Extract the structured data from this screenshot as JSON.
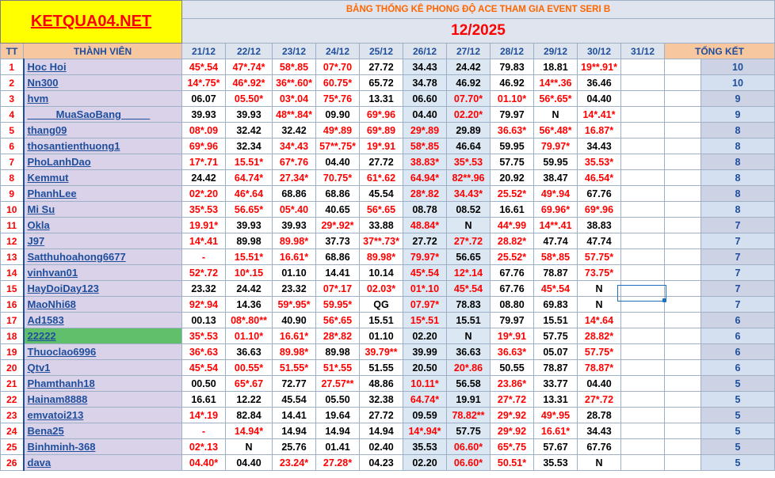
{
  "sheet": {
    "logo": "KETQUA04.NET",
    "title": "BẢNG THỐNG KÊ PHONG ĐỘ ACE THAM GIA EVENT SERI B",
    "period": "12/2025",
    "col_tt": "TT",
    "col_member": "THÀNH VIÊN",
    "col_total": "TỔNG KẾT",
    "dates": [
      "21/12",
      "22/12",
      "23/12",
      "24/12",
      "25/12",
      "26/12",
      "27/12",
      "28/12",
      "29/12",
      "30/12",
      "31/12"
    ]
  },
  "colors": {
    "red": "#ff0000",
    "black": "#000000",
    "name_bg": "#d9d2e9",
    "highlight": "#5fbf6a",
    "header_orange": "#f7c7a0"
  },
  "rows": [
    {
      "tt": "1",
      "name": "Hoc Hoi",
      "cells": [
        [
          "45*.54",
          "r"
        ],
        [
          "47*.74*",
          "r"
        ],
        [
          "58*.85",
          "r"
        ],
        [
          "07*.70",
          "r"
        ],
        [
          "27.72",
          "b"
        ],
        [
          "34.43",
          "b"
        ],
        [
          "24.42",
          "b"
        ],
        [
          "79.83",
          "b"
        ],
        [
          "18.81",
          "b"
        ],
        [
          "19**.91*",
          "r"
        ],
        [
          "",
          ""
        ]
      ],
      "total": "10"
    },
    {
      "tt": "2",
      "name": "Nn300",
      "cells": [
        [
          "14*.75*",
          "r"
        ],
        [
          "46*.92*",
          "r"
        ],
        [
          "36**.60*",
          "r"
        ],
        [
          "60.75*",
          "r"
        ],
        [
          "65.72",
          "b"
        ],
        [
          "34.78",
          "b"
        ],
        [
          "46.92",
          "b"
        ],
        [
          "46.92",
          "b"
        ],
        [
          "14**.36",
          "r"
        ],
        [
          "36.46",
          "b"
        ],
        [
          "",
          ""
        ]
      ],
      "total": "10"
    },
    {
      "tt": "3",
      "name": "hvm",
      "cells": [
        [
          "06.07",
          "b"
        ],
        [
          "05.50*",
          "r"
        ],
        [
          "03*.04",
          "r"
        ],
        [
          "75*.76",
          "r"
        ],
        [
          "13.31",
          "b"
        ],
        [
          "06.60",
          "b"
        ],
        [
          "07.70*",
          "r"
        ],
        [
          "01.10*",
          "r"
        ],
        [
          "56*.65*",
          "r"
        ],
        [
          "04.40",
          "b"
        ],
        [
          "",
          ""
        ]
      ],
      "total": "9"
    },
    {
      "tt": "4",
      "name": "_____MuaSaoBang_____",
      "cells": [
        [
          "39.93",
          "b"
        ],
        [
          "39.93",
          "b"
        ],
        [
          "48**.84*",
          "r"
        ],
        [
          "09.90",
          "b"
        ],
        [
          "69*.96",
          "r"
        ],
        [
          "04.40",
          "b"
        ],
        [
          "02.20*",
          "r"
        ],
        [
          "79.97",
          "b"
        ],
        [
          "N",
          "b"
        ],
        [
          "14*.41*",
          "r"
        ],
        [
          "",
          ""
        ]
      ],
      "total": "9"
    },
    {
      "tt": "5",
      "name": "thang09",
      "cells": [
        [
          "08*.09",
          "r"
        ],
        [
          "32.42",
          "b"
        ],
        [
          "32.42",
          "b"
        ],
        [
          "49*.89",
          "r"
        ],
        [
          "69*.89",
          "r"
        ],
        [
          "29*.89",
          "r"
        ],
        [
          "29.89",
          "b"
        ],
        [
          "36.63*",
          "r"
        ],
        [
          "56*.48*",
          "r"
        ],
        [
          "16.87*",
          "r"
        ],
        [
          "",
          ""
        ]
      ],
      "total": "8"
    },
    {
      "tt": "6",
      "name": "thosantienthuong1",
      "cells": [
        [
          "69*.96",
          "r"
        ],
        [
          "32.34",
          "b"
        ],
        [
          "34*.43",
          "r"
        ],
        [
          "57**.75*",
          "r"
        ],
        [
          "19*.91",
          "r"
        ],
        [
          "58*.85",
          "r"
        ],
        [
          "46.64",
          "b"
        ],
        [
          "59.95",
          "b"
        ],
        [
          "79.97*",
          "r"
        ],
        [
          "34.43",
          "b"
        ],
        [
          "",
          ""
        ]
      ],
      "total": "8"
    },
    {
      "tt": "7",
      "name": "PhoLanhDao",
      "cells": [
        [
          "17*.71",
          "r"
        ],
        [
          "15.51*",
          "r"
        ],
        [
          "67*.76",
          "r"
        ],
        [
          "04.40",
          "b"
        ],
        [
          "27.72",
          "b"
        ],
        [
          "38.83*",
          "r"
        ],
        [
          "35*.53",
          "r"
        ],
        [
          "57.75",
          "b"
        ],
        [
          "59.95",
          "b"
        ],
        [
          "35.53*",
          "r"
        ],
        [
          "",
          ""
        ]
      ],
      "total": "8"
    },
    {
      "tt": "8",
      "name": "Kemmut",
      "cells": [
        [
          "24.42",
          "b"
        ],
        [
          "64.74*",
          "r"
        ],
        [
          "27.34*",
          "r"
        ],
        [
          "70.75*",
          "r"
        ],
        [
          "61*.62",
          "r"
        ],
        [
          "64.94*",
          "r"
        ],
        [
          "82**.96",
          "r"
        ],
        [
          "20.92",
          "b"
        ],
        [
          "38.47",
          "b"
        ],
        [
          "46.54*",
          "r"
        ],
        [
          "",
          ""
        ]
      ],
      "total": "8"
    },
    {
      "tt": "9",
      "name": "PhanhLee",
      "cells": [
        [
          "02*.20",
          "r"
        ],
        [
          "46*.64",
          "r"
        ],
        [
          "68.86",
          "b"
        ],
        [
          "68.86",
          "b"
        ],
        [
          "45.54",
          "b"
        ],
        [
          "28*.82",
          "r"
        ],
        [
          "34.43*",
          "r"
        ],
        [
          "25.52*",
          "r"
        ],
        [
          "49*.94",
          "r"
        ],
        [
          "67.76",
          "b"
        ],
        [
          "",
          ""
        ]
      ],
      "total": "8"
    },
    {
      "tt": "10",
      "name": "Mi Su",
      "cells": [
        [
          "35*.53",
          "r"
        ],
        [
          "56.65*",
          "r"
        ],
        [
          "05*.40",
          "r"
        ],
        [
          "40.65",
          "b"
        ],
        [
          "56*.65",
          "r"
        ],
        [
          "08.78",
          "b"
        ],
        [
          "08.52",
          "b"
        ],
        [
          "16.61",
          "b"
        ],
        [
          "69.96*",
          "r"
        ],
        [
          "69*.96",
          "r"
        ],
        [
          "",
          ""
        ]
      ],
      "total": "8"
    },
    {
      "tt": "11",
      "name": "Okla",
      "cells": [
        [
          "19.91*",
          "r"
        ],
        [
          "39.93",
          "b"
        ],
        [
          "39.93",
          "b"
        ],
        [
          "29*.92*",
          "r"
        ],
        [
          "33.88",
          "b"
        ],
        [
          "48.84*",
          "r"
        ],
        [
          "N",
          "b"
        ],
        [
          "44*.99",
          "r"
        ],
        [
          "14**.41",
          "r"
        ],
        [
          "38.83",
          "b"
        ],
        [
          "",
          ""
        ]
      ],
      "total": "7"
    },
    {
      "tt": "12",
      "name": "J97",
      "cells": [
        [
          "14*.41",
          "r"
        ],
        [
          "89.98",
          "b"
        ],
        [
          "89.98*",
          "r"
        ],
        [
          "37.73",
          "b"
        ],
        [
          "37**.73*",
          "r"
        ],
        [
          "27.72",
          "b"
        ],
        [
          "27*.72",
          "r"
        ],
        [
          "28.82*",
          "r"
        ],
        [
          "47.74",
          "b"
        ],
        [
          "47.74",
          "b"
        ],
        [
          "",
          ""
        ]
      ],
      "total": "7"
    },
    {
      "tt": "13",
      "name": "Satthuhoahong6677",
      "cells": [
        [
          "-",
          "r"
        ],
        [
          "15.51*",
          "r"
        ],
        [
          "16.61*",
          "r"
        ],
        [
          "68.86",
          "b"
        ],
        [
          "89.98*",
          "r"
        ],
        [
          "79.97*",
          "r"
        ],
        [
          "56.65",
          "b"
        ],
        [
          "25.52*",
          "r"
        ],
        [
          "58*.85",
          "r"
        ],
        [
          "57.75*",
          "r"
        ],
        [
          "",
          ""
        ]
      ],
      "total": "7"
    },
    {
      "tt": "14",
      "name": "vinhvan01",
      "cells": [
        [
          "52*.72",
          "r"
        ],
        [
          "10*.15",
          "r"
        ],
        [
          "01.10",
          "b"
        ],
        [
          "14.41",
          "b"
        ],
        [
          "10.14",
          "b"
        ],
        [
          "45*.54",
          "r"
        ],
        [
          "12*.14",
          "r"
        ],
        [
          "67.76",
          "b"
        ],
        [
          "78.87",
          "b"
        ],
        [
          "73.75*",
          "r"
        ],
        [
          "",
          ""
        ]
      ],
      "total": "7"
    },
    {
      "tt": "15",
      "name": "HayDoiDay123",
      "cells": [
        [
          "23.32",
          "b"
        ],
        [
          "24.42",
          "b"
        ],
        [
          "23.32",
          "b"
        ],
        [
          "07*.17",
          "r"
        ],
        [
          "02.03*",
          "r"
        ],
        [
          "01*.10",
          "r"
        ],
        [
          "45*.54",
          "r"
        ],
        [
          "67.76",
          "b"
        ],
        [
          "45*.54",
          "r"
        ],
        [
          "N",
          "b"
        ],
        [
          "",
          ""
        ]
      ],
      "total": "7"
    },
    {
      "tt": "16",
      "name": "MaoNhi68",
      "cells": [
        [
          "92*.94",
          "r"
        ],
        [
          "14.36",
          "b"
        ],
        [
          "59*.95*",
          "r"
        ],
        [
          "59.95*",
          "r"
        ],
        [
          "QG",
          "b"
        ],
        [
          "07.97*",
          "r"
        ],
        [
          "78.83",
          "b"
        ],
        [
          "08.80",
          "b"
        ],
        [
          "69.83",
          "b"
        ],
        [
          "N",
          "b"
        ],
        [
          "",
          ""
        ]
      ],
      "total": "7"
    },
    {
      "tt": "17",
      "name": "Ad1583",
      "cells": [
        [
          "00.13",
          "b"
        ],
        [
          "08*.80**",
          "r"
        ],
        [
          "40.90",
          "b"
        ],
        [
          "56*.65",
          "r"
        ],
        [
          "15.51",
          "b"
        ],
        [
          "15*.51",
          "r"
        ],
        [
          "15.51",
          "b"
        ],
        [
          "79.97",
          "b"
        ],
        [
          "15.51",
          "b"
        ],
        [
          "14*.64",
          "r"
        ],
        [
          "",
          ""
        ]
      ],
      "total": "6"
    },
    {
      "tt": "18",
      "name": "22222",
      "hl": true,
      "cells": [
        [
          "35*.53",
          "r"
        ],
        [
          "01.10*",
          "r"
        ],
        [
          "16.61*",
          "r"
        ],
        [
          "28*.82",
          "r"
        ],
        [
          "01.10",
          "b"
        ],
        [
          "02.20",
          "b"
        ],
        [
          "N",
          "b"
        ],
        [
          "19*.91",
          "r"
        ],
        [
          "57.75",
          "b"
        ],
        [
          "28.82*",
          "r"
        ],
        [
          "",
          ""
        ]
      ],
      "total": "6"
    },
    {
      "tt": "19",
      "name": "Thuoclao6996",
      "cells": [
        [
          "36*.63",
          "r"
        ],
        [
          "36.63",
          "b"
        ],
        [
          "89.98*",
          "r"
        ],
        [
          "89.98",
          "b"
        ],
        [
          "39.79**",
          "r"
        ],
        [
          "39.99",
          "b"
        ],
        [
          "36.63",
          "b"
        ],
        [
          "36.63*",
          "r"
        ],
        [
          "05.07",
          "b"
        ],
        [
          "57.75*",
          "r"
        ],
        [
          "",
          ""
        ]
      ],
      "total": "6"
    },
    {
      "tt": "20",
      "name": "Qtv1",
      "cells": [
        [
          "45*.54",
          "r"
        ],
        [
          "00.55*",
          "r"
        ],
        [
          "51.55*",
          "r"
        ],
        [
          "51*.55",
          "r"
        ],
        [
          "51.55",
          "b"
        ],
        [
          "20.50",
          "b"
        ],
        [
          "20*.86",
          "r"
        ],
        [
          "50.55",
          "b"
        ],
        [
          "78.87",
          "b"
        ],
        [
          "78.87*",
          "r"
        ],
        [
          "",
          ""
        ]
      ],
      "total": "6"
    },
    {
      "tt": "21",
      "name": "Phamthanh18",
      "cells": [
        [
          "00.50",
          "b"
        ],
        [
          "65*.67",
          "r"
        ],
        [
          "72.77",
          "b"
        ],
        [
          "27.57**",
          "r"
        ],
        [
          "48.86",
          "b"
        ],
        [
          "10.11*",
          "r"
        ],
        [
          "56.58",
          "b"
        ],
        [
          "23.86*",
          "r"
        ],
        [
          "33.77",
          "b"
        ],
        [
          "04.40",
          "b"
        ],
        [
          "",
          ""
        ]
      ],
      "total": "5"
    },
    {
      "tt": "22",
      "name": "Hainam8888",
      "cells": [
        [
          "16.61",
          "b"
        ],
        [
          "12.22",
          "b"
        ],
        [
          "45.54",
          "b"
        ],
        [
          "05.50",
          "b"
        ],
        [
          "32.38",
          "b"
        ],
        [
          "64.74*",
          "r"
        ],
        [
          "19.91",
          "b"
        ],
        [
          "27*.72",
          "r"
        ],
        [
          "13.31",
          "b"
        ],
        [
          "27*.72",
          "r"
        ],
        [
          "",
          ""
        ]
      ],
      "total": "5"
    },
    {
      "tt": "23",
      "name": "emvatoi213",
      "cells": [
        [
          "14*.19",
          "r"
        ],
        [
          "82.84",
          "b"
        ],
        [
          "14.41",
          "b"
        ],
        [
          "19.64",
          "b"
        ],
        [
          "27.72",
          "b"
        ],
        [
          "09.59",
          "b"
        ],
        [
          "78.82**",
          "r"
        ],
        [
          "29*.92",
          "r"
        ],
        [
          "49*.95",
          "r"
        ],
        [
          "28.78",
          "b"
        ],
        [
          "",
          ""
        ]
      ],
      "total": "5"
    },
    {
      "tt": "24",
      "name": "Bena25",
      "cells": [
        [
          "-",
          "r"
        ],
        [
          "14.94*",
          "r"
        ],
        [
          "14.94",
          "b"
        ],
        [
          "14.94",
          "b"
        ],
        [
          "14.94",
          "b"
        ],
        [
          "14*.94*",
          "r"
        ],
        [
          "57.75",
          "b"
        ],
        [
          "29*.92",
          "r"
        ],
        [
          "16.61*",
          "r"
        ],
        [
          "34.43",
          "b"
        ],
        [
          "",
          ""
        ]
      ],
      "total": "5"
    },
    {
      "tt": "25",
      "name": "Binhminh-368",
      "cells": [
        [
          "02*.13",
          "r"
        ],
        [
          "N",
          "b"
        ],
        [
          "25.76",
          "b"
        ],
        [
          "01.41",
          "b"
        ],
        [
          "02.40",
          "b"
        ],
        [
          "35.53",
          "b"
        ],
        [
          "06.60*",
          "r"
        ],
        [
          "65*.75",
          "r"
        ],
        [
          "57.67",
          "b"
        ],
        [
          "67.76",
          "b"
        ],
        [
          "",
          ""
        ]
      ],
      "total": "5"
    },
    {
      "tt": "26",
      "name": "dava",
      "cells": [
        [
          "04.40*",
          "r"
        ],
        [
          "04.40",
          "b"
        ],
        [
          "23.24*",
          "r"
        ],
        [
          "27.28*",
          "r"
        ],
        [
          "04.23",
          "b"
        ],
        [
          "02.20",
          "b"
        ],
        [
          "06.60*",
          "r"
        ],
        [
          "50.51*",
          "r"
        ],
        [
          "35.53",
          "b"
        ],
        [
          "N",
          "b"
        ],
        [
          "",
          ""
        ]
      ],
      "total": "5"
    }
  ]
}
